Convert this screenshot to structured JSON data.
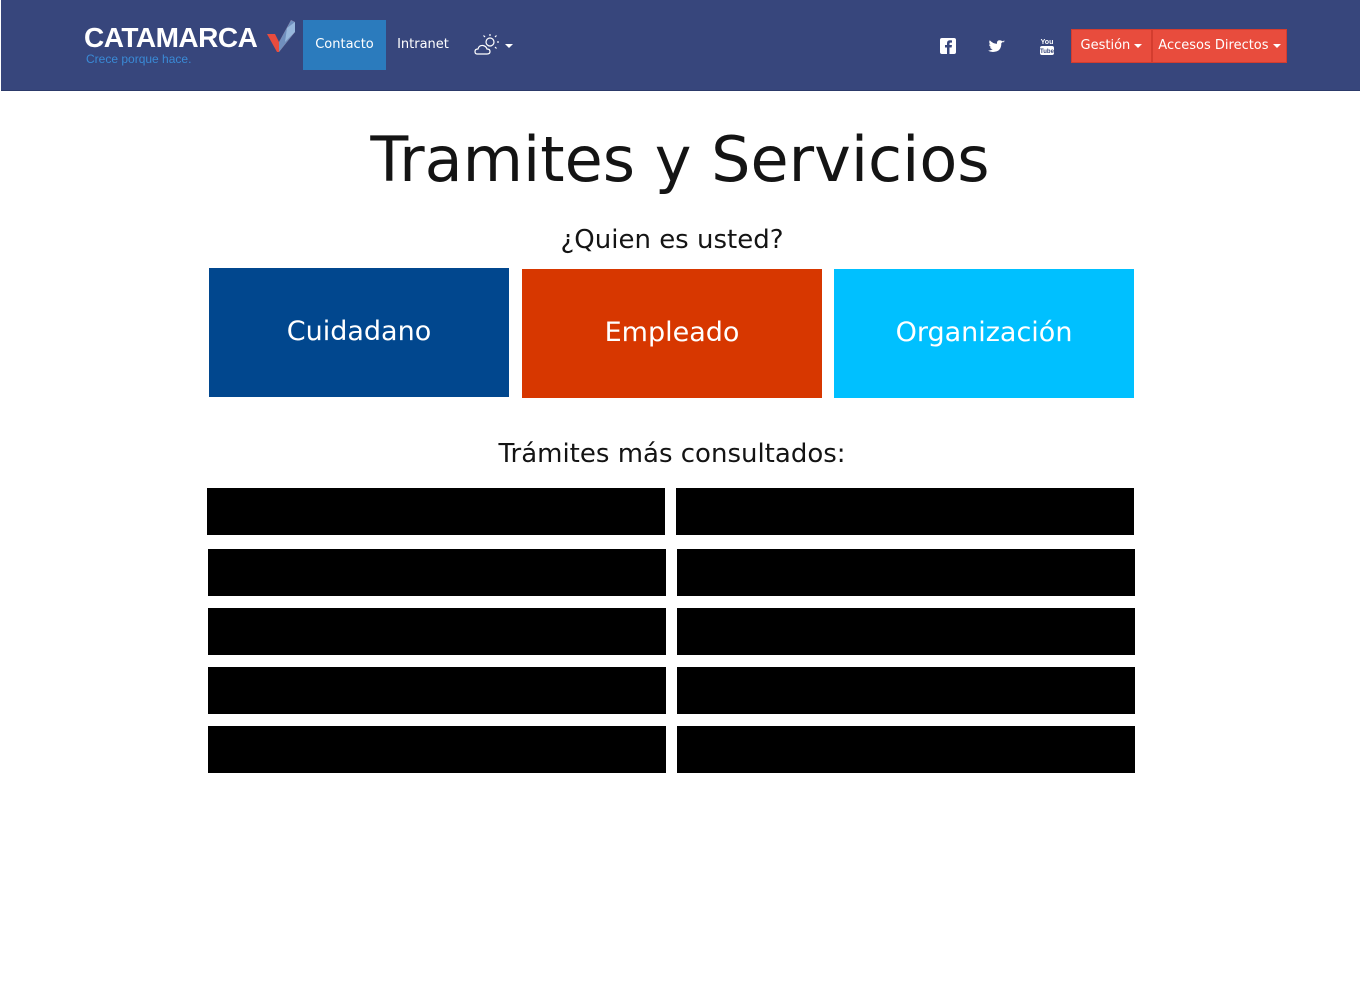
{
  "header": {
    "logo_title": "CATAMARCA",
    "logo_tagline": "Crece porque hace.",
    "nav": {
      "contacto": "Contacto",
      "intranet": "Intranet"
    },
    "weather_icon": "partly-cloudy-icon",
    "social": [
      "facebook-icon",
      "twitter-icon",
      "youtube-icon"
    ],
    "buttons": {
      "gestion": "Gestión",
      "accesos_directos": "Accesos Directos"
    }
  },
  "main": {
    "title": "Tramites y Servicios",
    "question": "¿Quien es usted?",
    "tiles": [
      {
        "label": "Cuidadano",
        "color": "#01478e"
      },
      {
        "label": "Empleado",
        "color": "#d73700"
      },
      {
        "label": "Organización",
        "color": "#00c0ff"
      }
    ],
    "most_consulted_title": "Trámites más consultados:",
    "tramites_redacted_count": 10
  },
  "colors": {
    "navbar": "#37467c",
    "nav_active": "#2b7bbd",
    "accent_red": "#e84c3d",
    "logo_blue": "#3a8ad6"
  }
}
